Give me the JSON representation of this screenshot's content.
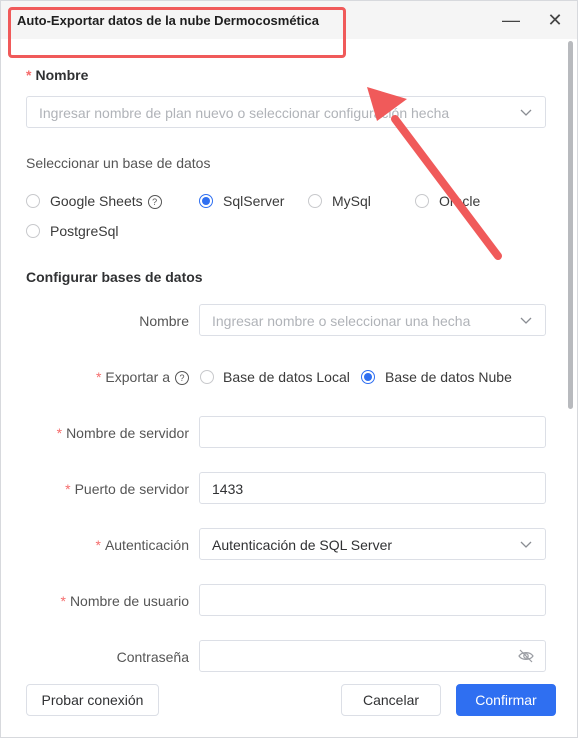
{
  "window": {
    "title": "Auto-Exportar datos de la nube Dermocosmética",
    "minimize_glyph": "—",
    "close_glyph": "✕"
  },
  "form": {
    "nombre_label": "Nombre",
    "nombre_placeholder": "Ingresar nombre de plan nuevo o seleccionar configuración hecha",
    "database_select_label": "Seleccionar un base de datos",
    "database_options": [
      "Google Sheets",
      "SqlServer",
      "MySql",
      "Oracle",
      "PostgreSql"
    ],
    "selected_database": "SqlServer",
    "configure_heading": "Configurar bases de datos",
    "config_nombre_label": "Nombre",
    "config_nombre_placeholder": "Ingresar nombre o seleccionar una hecha",
    "exportar_label": "Exportar a",
    "exportar_options": [
      "Base de datos Local",
      "Base de datos Nube"
    ],
    "selected_export": "Base de datos Nube",
    "server_name_label": "Nombre de servidor",
    "server_name_value": "",
    "port_label": "Puerto de servidor",
    "port_value": "1433",
    "auth_label": "Autenticación",
    "auth_value": "Autenticación de SQL Server",
    "username_label": "Nombre de usuario",
    "username_value": "",
    "password_label": "Contraseña",
    "password_value": ""
  },
  "footer": {
    "test_button": "Probar conexión",
    "cancel_button": "Cancelar",
    "confirm_button": "Confirmar"
  },
  "colors": {
    "primary": "#2f6ff1",
    "required_asterisk": "#f56c6c",
    "annotation": "#f05a5a"
  },
  "icons": {
    "help": "question-circle-icon",
    "dropdown": "chevron-down-icon",
    "password_toggle": "eye-off-icon"
  }
}
